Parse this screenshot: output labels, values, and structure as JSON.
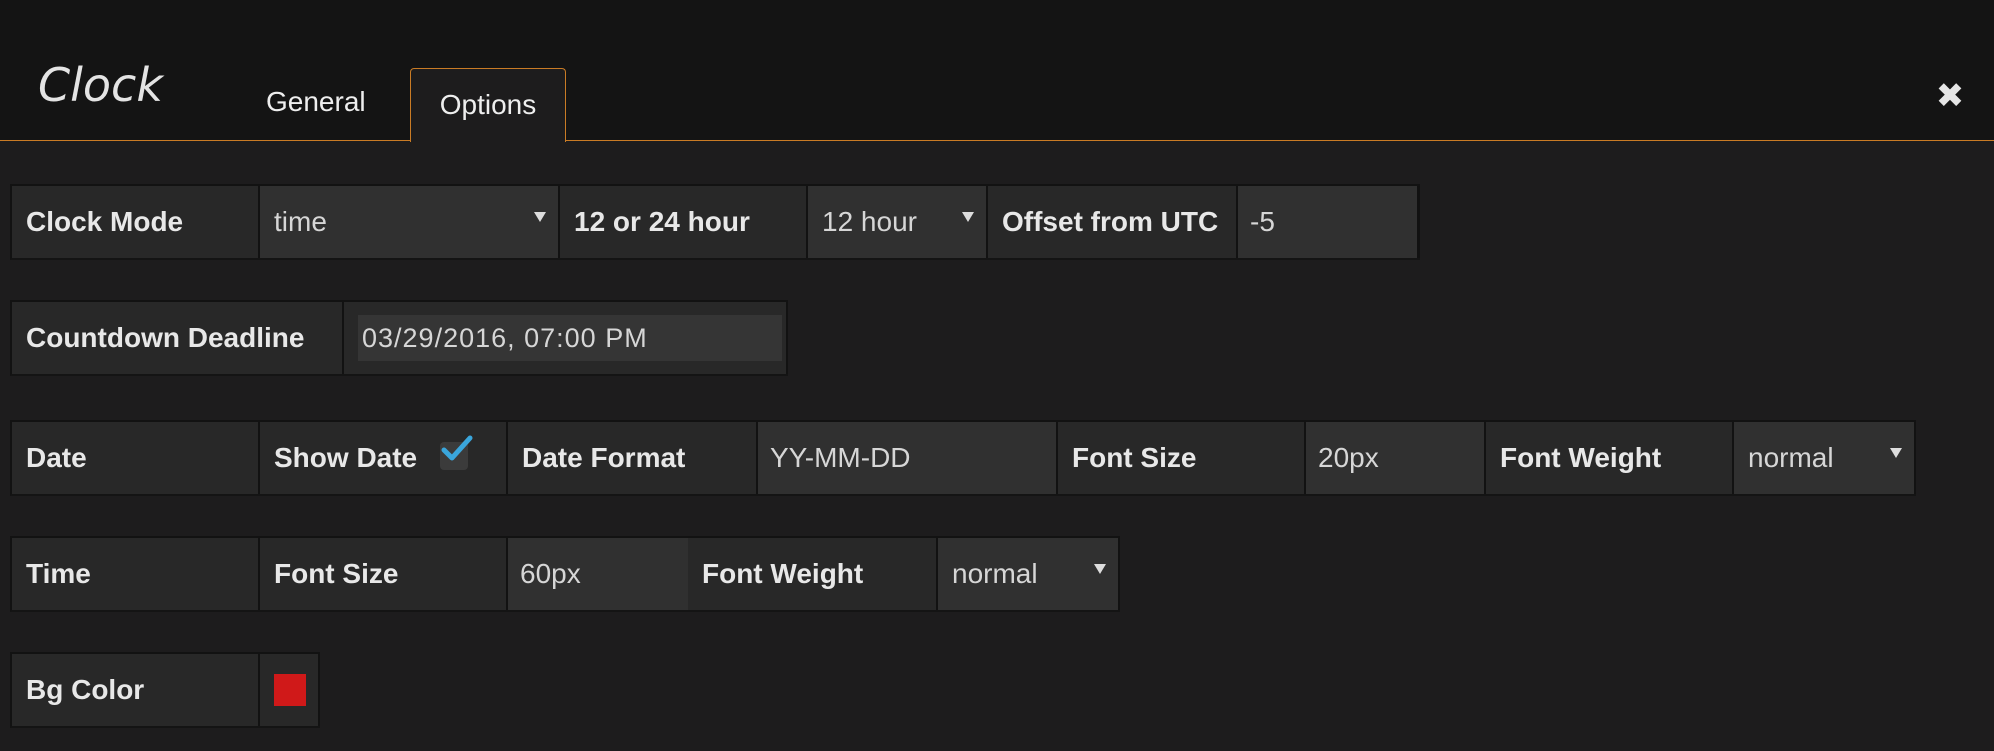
{
  "header": {
    "title": "Clock",
    "tabs": [
      {
        "label": "General"
      },
      {
        "label": "Options"
      }
    ],
    "close_glyph": "✖"
  },
  "clock_row": {
    "clock_mode_label": "Clock Mode",
    "clock_mode_value": "time",
    "hour_format_label": "12 or 24 hour",
    "hour_format_value": "12 hour",
    "offset_label": "Offset from UTC",
    "offset_value": "-5"
  },
  "countdown_row": {
    "label": "Countdown Deadline",
    "value": "03/29/2016, 07:00 PM"
  },
  "date_row": {
    "section_label": "Date",
    "show_date_label": "Show Date",
    "show_date_checked": true,
    "date_format_label": "Date Format",
    "date_format_value": "YY-MM-DD",
    "font_size_label": "Font Size",
    "font_size_value": "20px",
    "font_weight_label": "Font Weight",
    "font_weight_value": "normal"
  },
  "time_row": {
    "section_label": "Time",
    "font_size_label": "Font Size",
    "font_size_value": "60px",
    "font_weight_label": "Font Weight",
    "font_weight_value": "normal"
  },
  "bg_row": {
    "label": "Bg Color",
    "color": "#d01919"
  },
  "colors": {
    "accent": "#c97b25",
    "checkmark": "#3aa6dc",
    "background": "#1d1c1d",
    "header_background": "#141414"
  }
}
